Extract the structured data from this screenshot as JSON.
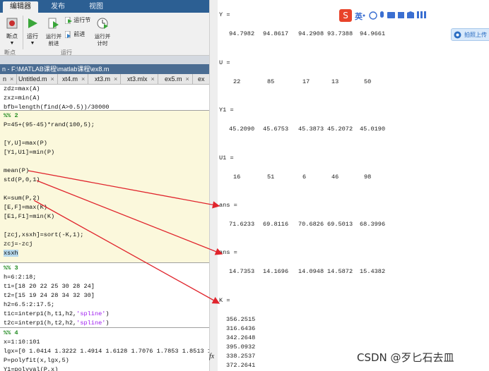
{
  "toolstrip": {
    "tabs": [
      {
        "label": "编辑器",
        "active": true
      },
      {
        "label": "发布",
        "active": false
      },
      {
        "label": "视图",
        "active": false
      }
    ],
    "buttons": {
      "breakpoint": "断点",
      "run": "运行",
      "run_advance": "运行并\n前进",
      "run_section": "运行节",
      "advance": "前进",
      "run_time": "运行并\n计时"
    },
    "groups": {
      "breakpoint": "断点",
      "run": "运行"
    }
  },
  "editor": {
    "path": "n - F:\\MATLAB课程\\matlab课程\\ex8.m",
    "file_tabs": [
      "n",
      "Untitled.m",
      "xt4.m",
      "xt3.m",
      "xt3.mlx",
      "ex5.m",
      "ex"
    ],
    "lines": {
      "l1": "zdz=max(A)",
      "l2": "zxz=min(A)",
      "l3": "bfb=length(find(A>0.5))/30000",
      "l4": "%% 2",
      "l5": "P=45+(95-45)*rand(100,5);",
      "l6": "[Y,U]=max(P)",
      "l7": "[Y1,U1]=min(P)",
      "l8": "mean(P)",
      "l9": "std(P,0,1)",
      "l10": "K=sum(P,2)",
      "l11": "[E,F]=max(K)",
      "l12": "[E1,F1]=min(K)",
      "l13": "[zcj,xsxh]=sort(-K,1);",
      "l14": "zcj=-zcj",
      "l15": "xsxh",
      "l16": "%% 3",
      "l17": "h=6:2:18;",
      "l18": "t1=[18 20 22 25 30 28 24]",
      "l19": "t2=[15 19 24 28 34 32 30]",
      "l20": "h2=6.5:2:17.5;",
      "l21a": "t1c=interp1(h,t1,h2,",
      "l21b": "'spline'",
      "l21c": ")",
      "l22a": "t2c=interp1(h,t2,h2,",
      "l22b": "'spline'",
      "l22c": ")",
      "l23": "%% 4",
      "l24": "x=1:10:101",
      "l25": "lgx=[0 1.0414 1.3222 1.4914 1.6128 1.7076 1.7853 1.8513 1.9085",
      "l26": "P=polyfit(x,lgx,5)",
      "l27": "Y1=polyval(P,x)"
    }
  },
  "command_window": {
    "blocks": [
      {
        "label": "Y =",
        "values": [
          "94.7982",
          "94.8617",
          "94.2908",
          "93.7388",
          "94.9661"
        ]
      },
      {
        "label": "U =",
        "values": [
          "22",
          "85",
          "17",
          "13",
          "50"
        ]
      },
      {
        "label": "Y1 =",
        "values": [
          "45.2090",
          "45.6753",
          "45.3873",
          "45.2072",
          "45.0190"
        ]
      },
      {
        "label": "U1 =",
        "values": [
          "16",
          "51",
          "6",
          "46",
          "98"
        ]
      },
      {
        "label": "ans =",
        "values": [
          "71.6233",
          "69.8116",
          "70.6826",
          "69.5013",
          "68.3996"
        ]
      },
      {
        "label": "ans =",
        "values": [
          "14.7353",
          "14.1696",
          "14.0948",
          "14.5872",
          "15.4382"
        ]
      }
    ],
    "k_label": "K =",
    "k_values": [
      "356.2515",
      "316.6436",
      "342.2648",
      "395.0932",
      "338.2537",
      "372.2641"
    ],
    "prompt_symbol": "fx"
  },
  "ime_toolbar": {
    "lang": "英"
  },
  "floating_button": {
    "label": "拍照上传"
  },
  "watermark": "CSDN @歹匕石去皿",
  "colors": {
    "arrow": "#e0242c",
    "cell_bg": "#fbf8dc",
    "highlight": "#f5d88c",
    "title_bar": "#2c5f93"
  }
}
